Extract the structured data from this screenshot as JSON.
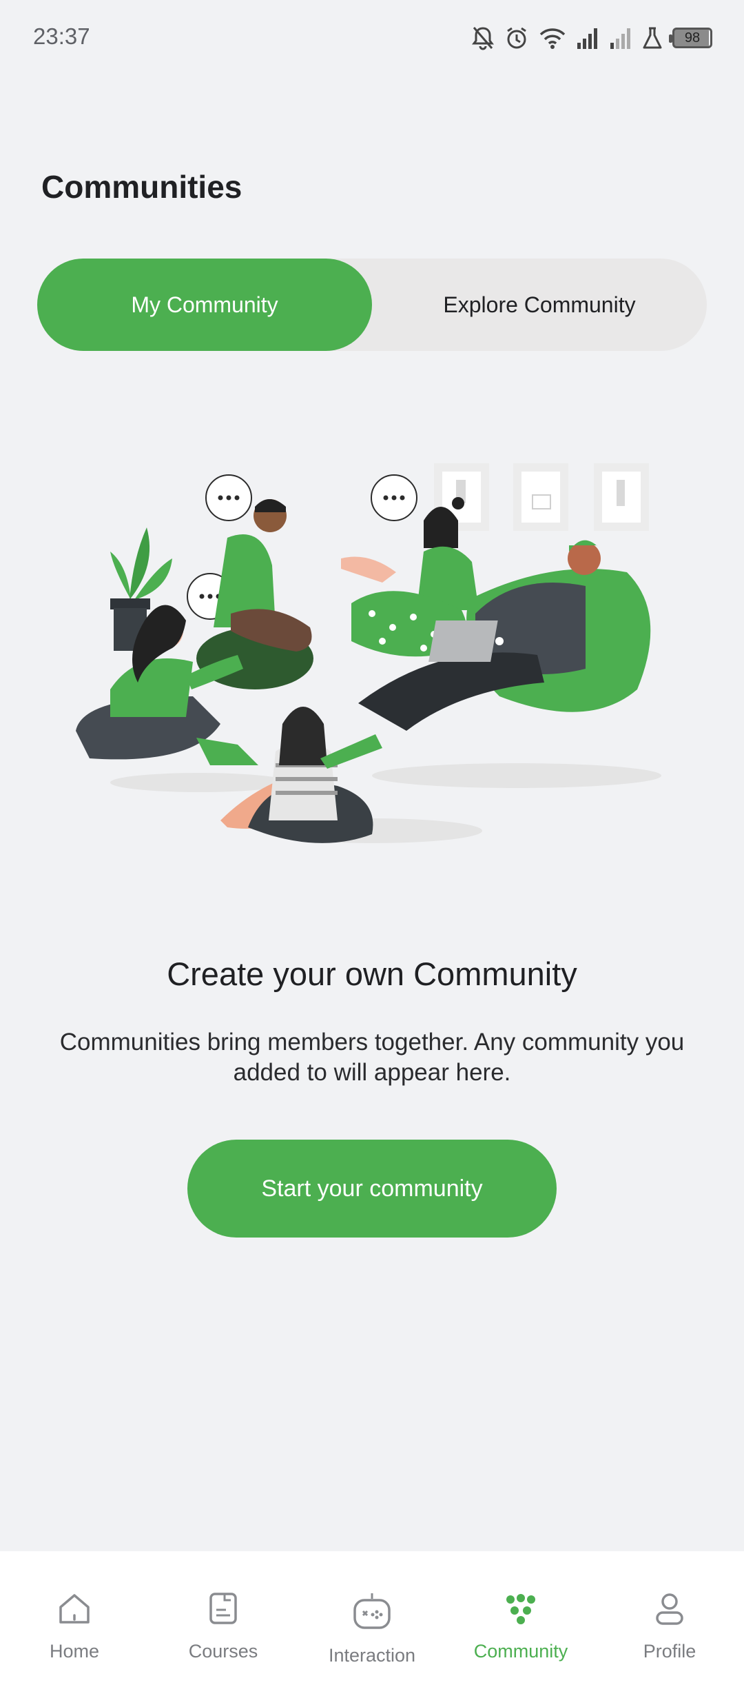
{
  "status": {
    "time": "23:37",
    "battery": "98"
  },
  "page": {
    "title": "Communities"
  },
  "tabs": [
    {
      "label": "My Community",
      "active": true
    },
    {
      "label": "Explore Community",
      "active": false
    }
  ],
  "empty_state": {
    "headline": "Create your own Community",
    "description": "Communities bring members together. Any community you added to will appear here.",
    "cta_label": "Start your community"
  },
  "bottom_nav": {
    "items": [
      {
        "label": "Home",
        "icon": "home-icon"
      },
      {
        "label": "Courses",
        "icon": "courses-icon"
      },
      {
        "label": "Interaction",
        "icon": "gamepad-icon"
      },
      {
        "label": "Community",
        "icon": "community-icon",
        "active": true
      },
      {
        "label": "Profile",
        "icon": "profile-icon"
      }
    ]
  },
  "colors": {
    "accent": "#4caf50",
    "background": "#f1f2f4",
    "tab_track": "#e9e8e8"
  }
}
